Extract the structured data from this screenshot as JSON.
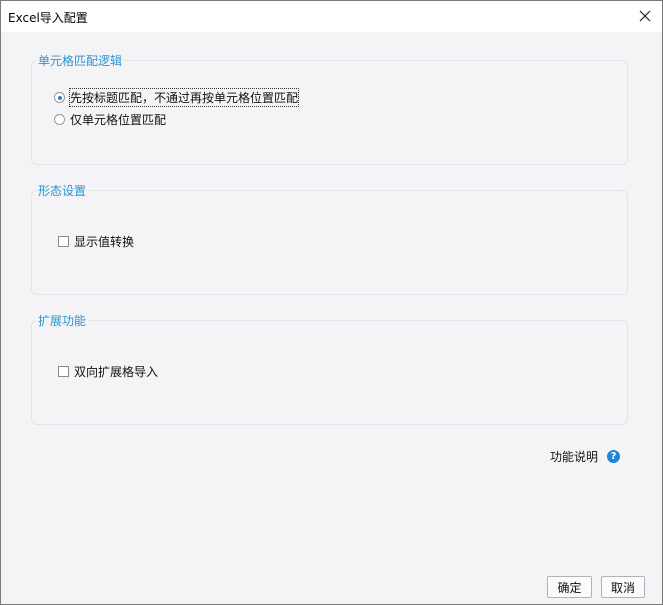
{
  "window": {
    "title": "Excel导入配置"
  },
  "groups": {
    "cell_match": {
      "legend": "单元格匹配逻辑",
      "options": [
        {
          "label": "先按标题匹配，不通过再按单元格位置匹配",
          "checked": true
        },
        {
          "label": "仅单元格位置匹配",
          "checked": false
        }
      ]
    },
    "display": {
      "legend": "形态设置",
      "option": {
        "label": "显示值转换",
        "checked": false
      }
    },
    "extension": {
      "legend": "扩展功能",
      "option": {
        "label": "双向扩展格导入",
        "checked": false
      }
    }
  },
  "help": {
    "label": "功能说明",
    "icon": "question-circle-icon",
    "icon_glyph": "?"
  },
  "buttons": {
    "ok": "确定",
    "cancel": "取消"
  },
  "colors": {
    "accent": "#2a95d3",
    "help_icon": "#1f86d8"
  }
}
